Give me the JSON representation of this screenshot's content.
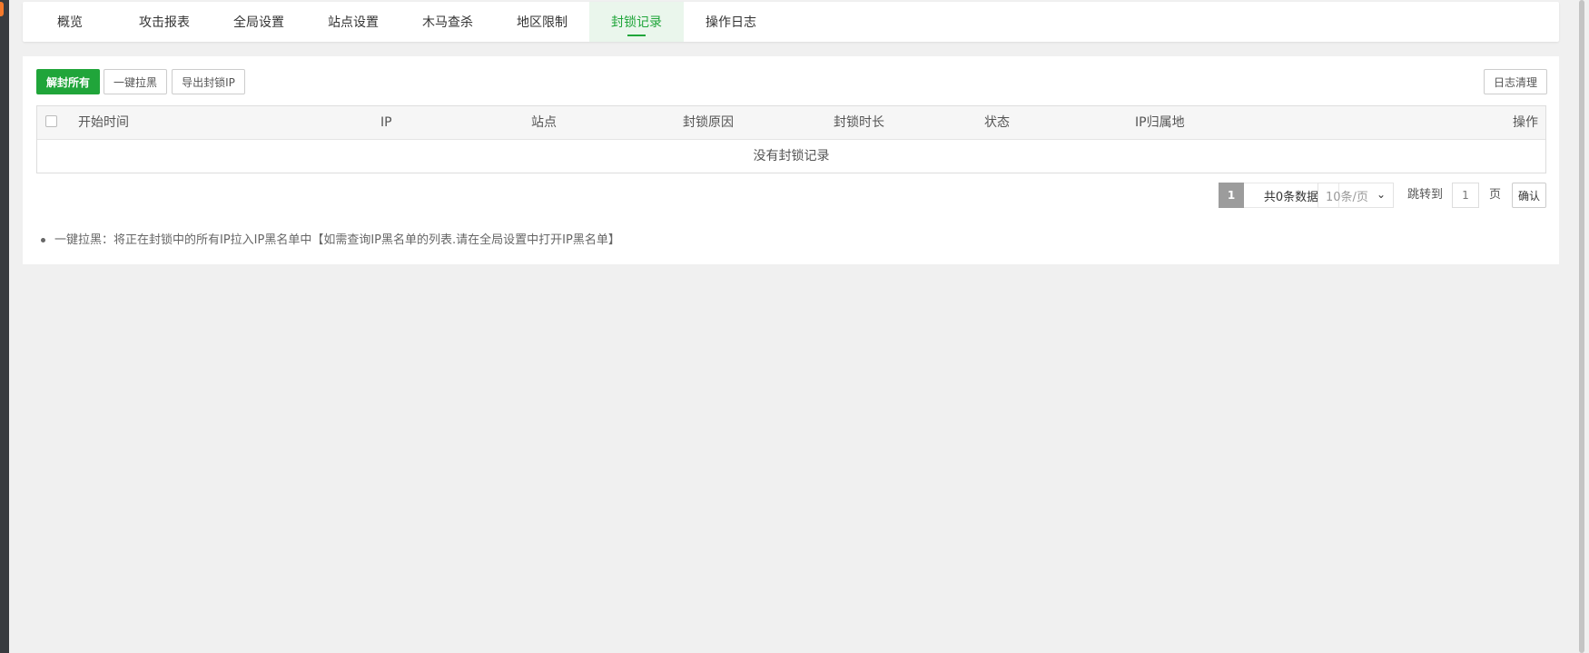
{
  "tabs": [
    {
      "label": "概览",
      "active": false
    },
    {
      "label": "攻击报表",
      "active": false
    },
    {
      "label": "全局设置",
      "active": false
    },
    {
      "label": "站点设置",
      "active": false
    },
    {
      "label": "木马查杀",
      "active": false
    },
    {
      "label": "地区限制",
      "active": false
    },
    {
      "label": "封锁记录",
      "active": true
    },
    {
      "label": "操作日志",
      "active": false
    }
  ],
  "toolbar": {
    "unblock_all": "解封所有",
    "blacklist_all": "一键拉黑",
    "export_ip": "导出封锁IP",
    "clear_log": "日志清理"
  },
  "table": {
    "columns": [
      "开始时间",
      "IP",
      "站点",
      "封锁原因",
      "封锁时长",
      "状态",
      "IP归属地",
      "操作"
    ],
    "empty_text": "没有封锁记录",
    "rows": []
  },
  "pagination": {
    "current_page": "1",
    "total_text": "共0条数据",
    "page_size": "10条/页",
    "jump_label": "跳转到",
    "jump_value": "1",
    "page_label": "页",
    "confirm": "确认"
  },
  "notes": [
    "一键拉黑：将正在封锁中的所有IP拉入IP黑名单中【如需查询IP黑名单的列表.请在全局设置中打开IP黑名单】"
  ],
  "colors": {
    "accent": "#20a53a",
    "active_tab_bg": "#eaf6ec",
    "page_bg": "#f0f0f0"
  }
}
